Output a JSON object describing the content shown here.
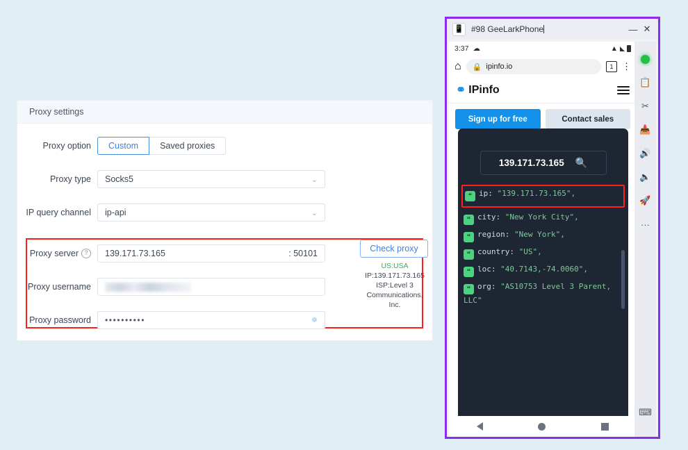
{
  "proxy_panel": {
    "title": "Proxy settings",
    "proxy_option": {
      "label": "Proxy option",
      "options": [
        "Custom",
        "Saved proxies"
      ],
      "selected": "Custom"
    },
    "proxy_type": {
      "label": "Proxy type",
      "value": "Socks5"
    },
    "ip_query_channel": {
      "label": "IP query channel",
      "value": "ip-api"
    },
    "proxy_server": {
      "label": "Proxy server",
      "help_icon": "question-mark-icon",
      "host": "139.171.73.165",
      "port": ": 50101"
    },
    "proxy_username": {
      "label": "Proxy username",
      "value": ""
    },
    "proxy_password": {
      "label": "Proxy password",
      "value": "••••••••••",
      "reveal_icon": "eye-slash-icon"
    },
    "check_proxy": {
      "button_label": "Check proxy",
      "geo": "US:USA",
      "ip_line": "IP:139.171.73.165",
      "isp_line_1": "ISP:Level 3",
      "isp_line_2": "Communications,",
      "isp_line_3": "Inc."
    }
  },
  "phone_window": {
    "title": "#98 GeeLarkPhone",
    "app_icon": "phone-app-icon",
    "minimize_label": "—",
    "close_label": "✕",
    "status_bar": {
      "time": "3:37",
      "cloud_icon": "cloud-icon",
      "wifi_icon": "wifi-icon",
      "signal_icon": "signal-icon",
      "battery_icon": "battery-icon"
    },
    "browser": {
      "home_icon": "home-icon",
      "lock_icon": "lock-icon",
      "url": "ipinfo.io",
      "tab_count": "1",
      "menu_icon": "overflow-menu-icon"
    },
    "site": {
      "brand": "IPinfo",
      "brand_logo": "ipinfo-pin-logo",
      "menu_icon": "hamburger-icon",
      "signup_label": "Sign up for free",
      "contact_label": "Contact sales",
      "search_value": "139.171.73.165",
      "search_icon": "magnifier-icon",
      "json_entries": [
        {
          "key": "ip",
          "value": "\"139.171.73.165\",",
          "highlighted": true
        },
        {
          "key": "city",
          "value": "\"New York City\",",
          "highlighted": false
        },
        {
          "key": "region",
          "value": "\"New York\",",
          "highlighted": false
        },
        {
          "key": "country",
          "value": "\"US\",",
          "highlighted": false
        },
        {
          "key": "loc",
          "value": "\"40.7143,-74.0060\",",
          "highlighted": false
        },
        {
          "key": "org",
          "value": "\"AS10753 Level 3 Parent, LLC\"",
          "highlighted": false
        }
      ]
    },
    "nav_bar": {
      "back_icon": "back-triangle-icon",
      "home_icon": "home-circle-icon",
      "recents_icon": "recents-square-icon"
    },
    "side_toolbar": [
      {
        "icon": "status-online-dot",
        "glyph": ""
      },
      {
        "icon": "clipboard-icon",
        "glyph": "⎙"
      },
      {
        "icon": "scissors-icon",
        "glyph": "✂"
      },
      {
        "icon": "inbox-download-icon",
        "glyph": "⎘"
      },
      {
        "icon": "volume-up-icon",
        "glyph": "🔊"
      },
      {
        "icon": "volume-down-icon",
        "glyph": "🔉"
      },
      {
        "icon": "rocket-boost-icon",
        "glyph": "🚀"
      },
      {
        "icon": "more-options-icon",
        "glyph": "···"
      }
    ],
    "keyboard_icon": "keyboard-input-icon"
  },
  "colors": {
    "page_background": "#dfeef5",
    "accent_blue": "#3b82e8",
    "highlight_red": "#ff1f1f",
    "window_border_purple": "#8b2df0",
    "dark_panel": "#1e2533",
    "success_green": "#3aa655"
  }
}
